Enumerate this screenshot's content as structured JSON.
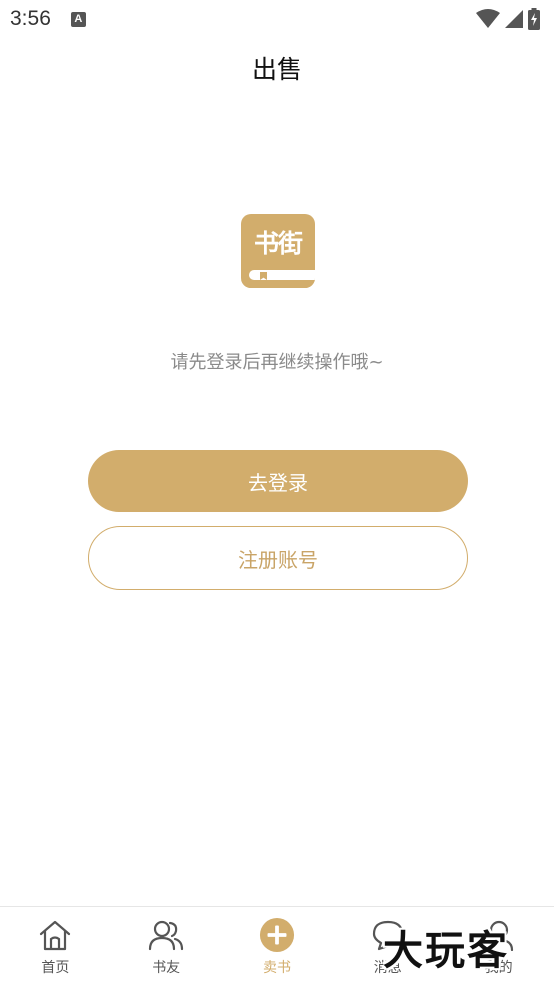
{
  "status_bar": {
    "time": "3:56",
    "notification_icon": "A",
    "icons": [
      "wifi-icon",
      "signal-icon",
      "battery-icon"
    ]
  },
  "header": {
    "title": "出售"
  },
  "logo": {
    "text": "书街"
  },
  "main": {
    "prompt": "请先登录后再继续操作哦~",
    "login_label": "去登录",
    "register_label": "注册账号"
  },
  "tabbar": {
    "items": [
      {
        "label": "首页",
        "icon": "home-icon",
        "active": false
      },
      {
        "label": "书友",
        "icon": "friends-icon",
        "active": false
      },
      {
        "label": "卖书",
        "icon": "plus-circle-icon",
        "active": true
      },
      {
        "label": "消息",
        "icon": "message-icon",
        "active": false
      },
      {
        "label": "我的",
        "icon": "profile-icon",
        "active": false
      }
    ]
  },
  "watermark": {
    "text": "大玩客"
  },
  "colors": {
    "accent": "#d2ad6c",
    "text_muted": "#8a8a8a"
  }
}
